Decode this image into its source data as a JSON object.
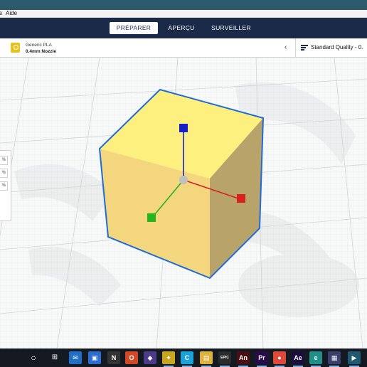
{
  "menubar": {
    "prev_fragment": "s",
    "aide": "Aide"
  },
  "stages": {
    "prepare": "PRÉPARER",
    "preview": "APERÇU",
    "monitor": "SURVEILLER"
  },
  "extruder": {
    "material": "Generic PLA",
    "nozzle": "0.4mm Nozzle",
    "badge_color": "#e8c21a"
  },
  "print_settings": {
    "quality": "Standard Quality - 0."
  },
  "scale_panel": {
    "fields": [
      "%",
      "%",
      "%"
    ]
  },
  "colors": {
    "accent": "#1b2a49",
    "cube_top": "#fdf07e",
    "cube_front": "#f3d67e",
    "cube_right": "#b8a46a",
    "selection_outline": "#1e6bd9",
    "axis_x": "#d8201f",
    "axis_y": "#1520c8",
    "axis_z": "#25b51f"
  },
  "taskbar": {
    "icons": [
      {
        "name": "search",
        "glyph": "○",
        "bg": "transparent"
      },
      {
        "name": "task-view",
        "glyph": "⊞",
        "bg": "transparent"
      },
      {
        "name": "mail",
        "glyph": "✉",
        "bg": "#1f6ec8"
      },
      {
        "name": "store",
        "glyph": "▣",
        "bg": "#2a6fd0"
      },
      {
        "name": "n-app",
        "glyph": "N",
        "bg": "#333"
      },
      {
        "name": "office",
        "glyph": "O",
        "bg": "#d24726"
      },
      {
        "name": "3d-app",
        "glyph": "◆",
        "bg": "#4d3b8a"
      },
      {
        "name": "games",
        "glyph": "✦",
        "bg": "#c9a620"
      },
      {
        "name": "cura",
        "glyph": "C",
        "bg": "#1aa3d8"
      },
      {
        "name": "file-explorer",
        "glyph": "▤",
        "bg": "#e0b23a"
      },
      {
        "name": "epic-games",
        "glyph": "EPIC",
        "bg": "#2b2b2b"
      },
      {
        "name": "animate",
        "glyph": "An",
        "bg": "#4b0f12"
      },
      {
        "name": "premiere",
        "glyph": "Pr",
        "bg": "#2a0b4a"
      },
      {
        "name": "chrome",
        "glyph": "●",
        "bg": "#dd4a3a"
      },
      {
        "name": "after-effects",
        "glyph": "Ae",
        "bg": "#1b0d3d"
      },
      {
        "name": "edge",
        "glyph": "e",
        "bg": "#1f8f8a"
      },
      {
        "name": "app-extra",
        "glyph": "▦",
        "bg": "#3b3f6b"
      },
      {
        "name": "app-last",
        "glyph": "▶",
        "bg": "#205a70"
      }
    ]
  }
}
